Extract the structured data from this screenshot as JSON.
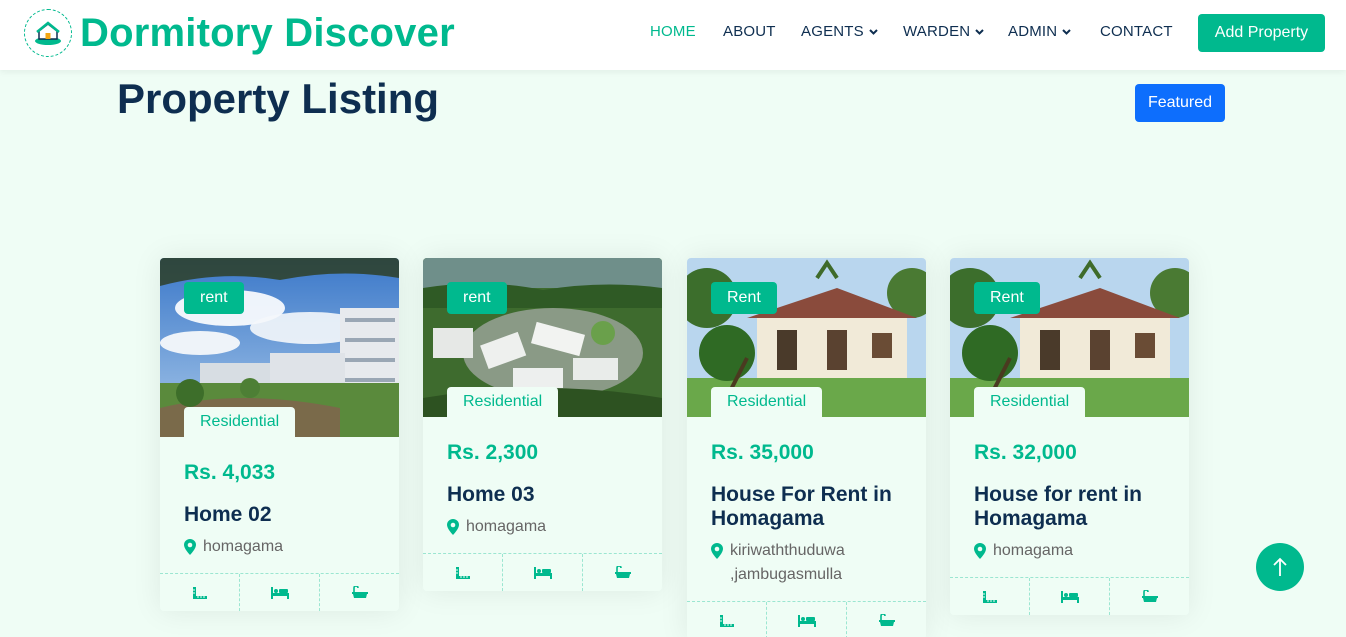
{
  "brand": {
    "name": "Dormitory Discover",
    "logo_icon": "house-logo-icon"
  },
  "nav": {
    "items": [
      {
        "label": "HOME",
        "active": true,
        "dropdown": false
      },
      {
        "label": "ABOUT",
        "active": false,
        "dropdown": false
      },
      {
        "label": "AGENTS",
        "active": false,
        "dropdown": true
      },
      {
        "label": "WARDEN",
        "active": false,
        "dropdown": true
      },
      {
        "label": "ADMIN",
        "active": false,
        "dropdown": true
      },
      {
        "label": "CONTACT",
        "active": false,
        "dropdown": false
      }
    ],
    "cta": "Add Property"
  },
  "header": {
    "title": "Property Listing",
    "filter_button": "Featured"
  },
  "listings": [
    {
      "status": "rent",
      "type": "Residential",
      "price": "Rs. 4,033",
      "title": "Home 02",
      "location": "homagama"
    },
    {
      "status": "rent",
      "type": "Residential",
      "price": "Rs. 2,300",
      "title": "Home 03",
      "location": "homagama"
    },
    {
      "status": "Rent",
      "type": "Residential",
      "price": "Rs. 35,000",
      "title": "House For Rent in Homagama",
      "location": "kiriwaththuduwa ,jambugasmulla"
    },
    {
      "status": "Rent",
      "type": "Residential",
      "price": "Rs. 32,000",
      "title": "House for rent in Homagama",
      "location": "homagama"
    }
  ],
  "colors": {
    "primary": "#00b98e",
    "dark": "#0e2e50",
    "featured": "#0d6efd",
    "background": "#effdf5"
  },
  "icons": [
    "map-marker-icon",
    "ruler-icon",
    "bed-icon",
    "bath-icon",
    "arrow-up-icon"
  ]
}
